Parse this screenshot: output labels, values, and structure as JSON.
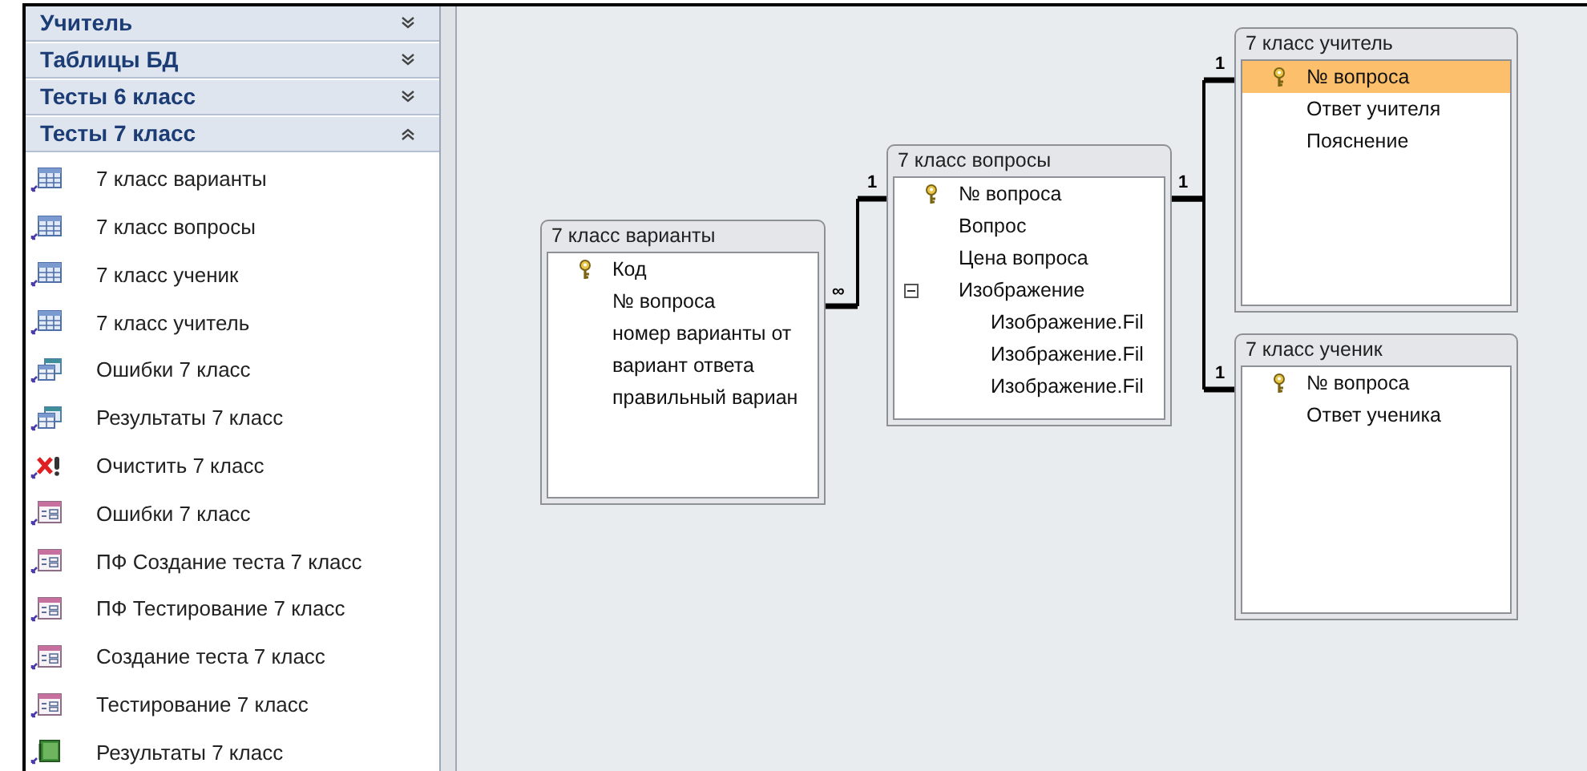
{
  "navigation_pane": {
    "groups": [
      {
        "title": "Учитель",
        "expanded": false
      },
      {
        "title": "Таблицы БД",
        "expanded": false
      },
      {
        "title": "Тесты 6 класс",
        "expanded": false
      },
      {
        "title": "Тесты 7 класс",
        "expanded": true,
        "items": [
          {
            "kind": "table",
            "label": "7 класс варианты"
          },
          {
            "kind": "table",
            "label": "7 класс вопросы"
          },
          {
            "kind": "table",
            "label": "7 класс ученик"
          },
          {
            "kind": "table",
            "label": "7 класс учитель"
          },
          {
            "kind": "query",
            "label": "Ошибки 7 класс"
          },
          {
            "kind": "query",
            "label": "Результаты 7 класс"
          },
          {
            "kind": "macro",
            "label": "Очистить 7 класс"
          },
          {
            "kind": "form",
            "label": "Ошибки 7 класс"
          },
          {
            "kind": "form",
            "label": "ПФ Создание теста 7 класс"
          },
          {
            "kind": "form",
            "label": "ПФ Тестирование 7 класс"
          },
          {
            "kind": "form",
            "label": "Создание теста 7 класс"
          },
          {
            "kind": "form",
            "label": "Тестирование 7 класс"
          },
          {
            "kind": "report",
            "label": "Результаты 7 класс"
          }
        ]
      }
    ]
  },
  "relationships_diagram": {
    "tables": [
      {
        "title": "7 класс варианты",
        "fields": [
          {
            "name": "Код",
            "primary_key": true,
            "selected": false
          },
          {
            "name": "№ вопроса",
            "primary_key": false,
            "selected": false
          },
          {
            "name": "номер варианты от",
            "primary_key": false,
            "selected": false
          },
          {
            "name": "вариант ответа",
            "primary_key": false,
            "selected": false
          },
          {
            "name": "правильный вариан",
            "primary_key": false,
            "selected": false
          }
        ]
      },
      {
        "title": "7 класс вопросы",
        "fields": [
          {
            "name": "№ вопроса",
            "primary_key": true,
            "selected": false
          },
          {
            "name": "Вопрос",
            "primary_key": false,
            "selected": false
          },
          {
            "name": "Цена вопроса",
            "primary_key": false,
            "selected": false
          },
          {
            "name": "Изображение",
            "primary_key": false,
            "selected": false,
            "expanded": true,
            "children": [
              {
                "name": "Изображение.Fil",
                "primary_key": false,
                "selected": false
              },
              {
                "name": "Изображение.Fil",
                "primary_key": false,
                "selected": false
              },
              {
                "name": "Изображение.Fil",
                "primary_key": false,
                "selected": false
              }
            ]
          }
        ]
      },
      {
        "title": "7 класс учитель",
        "fields": [
          {
            "name": "№ вопроса",
            "primary_key": true,
            "selected": true
          },
          {
            "name": "Ответ учителя",
            "primary_key": false,
            "selected": false
          },
          {
            "name": "Пояснение",
            "primary_key": false,
            "selected": false
          }
        ]
      },
      {
        "title": "7 класс ученик",
        "fields": [
          {
            "name": "№ вопроса",
            "primary_key": true,
            "selected": false
          },
          {
            "name": "Ответ ученика",
            "primary_key": false,
            "selected": false
          }
        ]
      }
    ],
    "relationships": [
      {
        "from_label": "∞",
        "to_label": "1"
      },
      {
        "from_label": "1",
        "to_label": "1"
      },
      {
        "to_label": "1"
      }
    ]
  }
}
